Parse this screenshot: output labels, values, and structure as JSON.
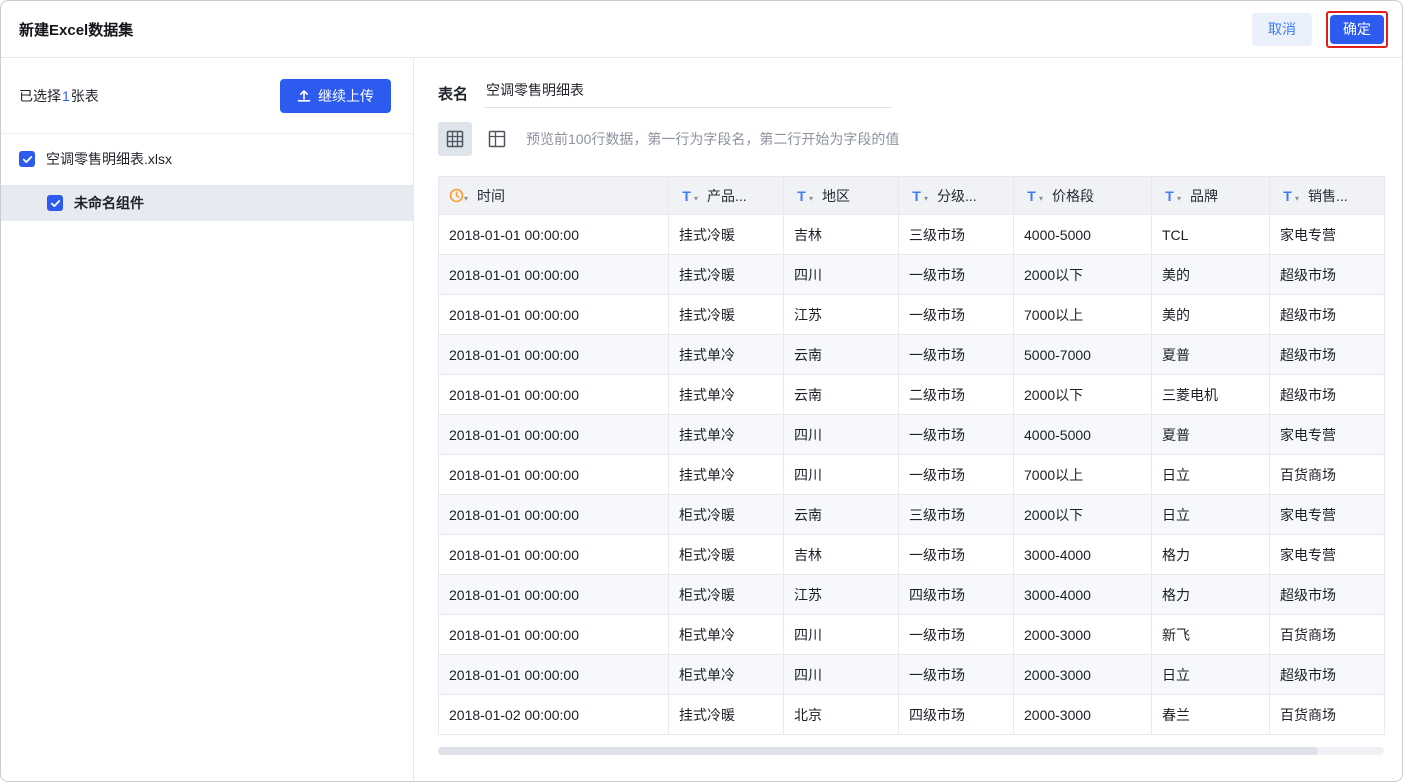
{
  "colors": {
    "primary": "#2e5bef",
    "text_icon_blue": "#3c7bf5",
    "clock_icon_orange": "#ff9c2e",
    "annotation_red": "#e01e1e"
  },
  "header": {
    "title": "新建Excel数据集",
    "cancel_label": "取消",
    "confirm_label": "确定"
  },
  "sidebar": {
    "selected_prefix": "已选择",
    "selected_count": "1",
    "selected_suffix": "张表",
    "upload_button_label": "继续上传",
    "file_name": "空调零售明细表.xlsx",
    "file_checked": true,
    "sheet_name": "未命名组件",
    "sheet_checked": true
  },
  "main": {
    "table_name_label": "表名",
    "table_name_value": "空调零售明细表",
    "preview_hint": "预览前100行数据，第一行为字段名，第二行开始为字段的值"
  },
  "table": {
    "columns": [
      {
        "label": "时间",
        "type": "date"
      },
      {
        "label": "产品...",
        "type": "text"
      },
      {
        "label": "地区",
        "type": "text"
      },
      {
        "label": "分级...",
        "type": "text"
      },
      {
        "label": "价格段",
        "type": "text"
      },
      {
        "label": "品牌",
        "type": "text"
      },
      {
        "label": "销售...",
        "type": "text"
      }
    ],
    "rows": [
      [
        "2018-01-01 00:00:00",
        "挂式冷暖",
        "吉林",
        "三级市场",
        "4000-5000",
        "TCL",
        "家电专营"
      ],
      [
        "2018-01-01 00:00:00",
        "挂式冷暖",
        "四川",
        "一级市场",
        "2000以下",
        "美的",
        "超级市场"
      ],
      [
        "2018-01-01 00:00:00",
        "挂式冷暖",
        "江苏",
        "一级市场",
        "7000以上",
        "美的",
        "超级市场"
      ],
      [
        "2018-01-01 00:00:00",
        "挂式单冷",
        "云南",
        "一级市场",
        "5000-7000",
        "夏普",
        "超级市场"
      ],
      [
        "2018-01-01 00:00:00",
        "挂式单冷",
        "云南",
        "二级市场",
        "2000以下",
        "三菱电机",
        "超级市场"
      ],
      [
        "2018-01-01 00:00:00",
        "挂式单冷",
        "四川",
        "一级市场",
        "4000-5000",
        "夏普",
        "家电专营"
      ],
      [
        "2018-01-01 00:00:00",
        "挂式单冷",
        "四川",
        "一级市场",
        "7000以上",
        "日立",
        "百货商场"
      ],
      [
        "2018-01-01 00:00:00",
        "柜式冷暖",
        "云南",
        "三级市场",
        "2000以下",
        "日立",
        "家电专营"
      ],
      [
        "2018-01-01 00:00:00",
        "柜式冷暖",
        "吉林",
        "一级市场",
        "3000-4000",
        "格力",
        "家电专营"
      ],
      [
        "2018-01-01 00:00:00",
        "柜式冷暖",
        "江苏",
        "四级市场",
        "3000-4000",
        "格力",
        "超级市场"
      ],
      [
        "2018-01-01 00:00:00",
        "柜式单冷",
        "四川",
        "一级市场",
        "2000-3000",
        "新飞",
        "百货商场"
      ],
      [
        "2018-01-01 00:00:00",
        "柜式单冷",
        "四川",
        "一级市场",
        "2000-3000",
        "日立",
        "超级市场"
      ],
      [
        "2018-01-02 00:00:00",
        "挂式冷暖",
        "北京",
        "四级市场",
        "2000-3000",
        "春兰",
        "百货商场"
      ]
    ]
  }
}
